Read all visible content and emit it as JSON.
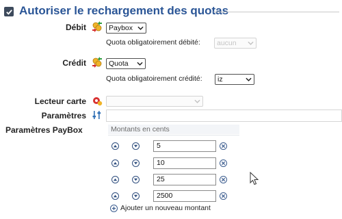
{
  "section": {
    "title": "Autoriser le rechargement des quotas",
    "checked": true
  },
  "debit": {
    "label": "Débit",
    "icon": "coins-transfer-icon",
    "select_value": "Paybox",
    "quota_label": "Quota obligatoirement débité:",
    "quota_value": "aucun",
    "quota_disabled": true
  },
  "credit": {
    "label": "Crédit",
    "icon": "coins-transfer-icon",
    "select_value": "Quota",
    "quota_label": "Quota obligatoirement crédité:",
    "quota_value": "iz"
  },
  "card_reader": {
    "label": "Lecteur carte",
    "icon": "card-reader-gear-icon",
    "disabled": true
  },
  "parameters": {
    "label": "Paramètres",
    "icon": "sliders-icon"
  },
  "paybox": {
    "label": "Paramètres PayBox",
    "header": "Montants en cents",
    "amounts": [
      "5",
      "10",
      "25",
      "2500"
    ],
    "add_label": "Ajouter un nouveau montant"
  },
  "colors": {
    "title": "#2a5596",
    "checkbox": "#3d4a5c",
    "icon_blue": "#2f4e7e"
  }
}
